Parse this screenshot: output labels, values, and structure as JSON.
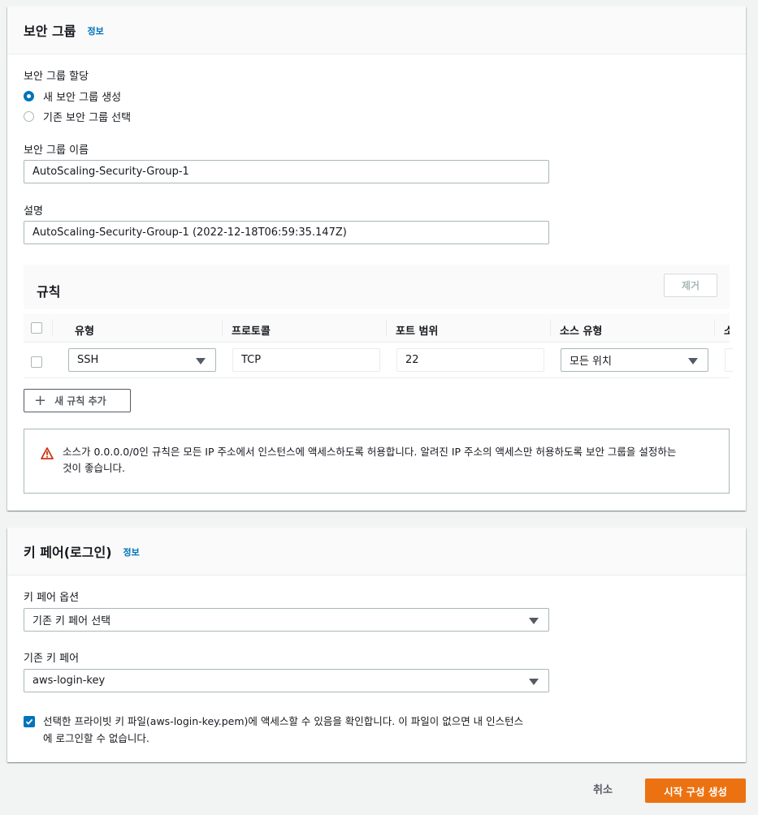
{
  "security_group": {
    "title": "보안 그룹",
    "info": "정보",
    "assign_label": "보안 그룹 할당",
    "radio_new": "새 보안 그룹 생성",
    "radio_existing": "기존 보안 그룹 선택",
    "name_label": "보안 그룹 이름",
    "name_value": "AutoScaling-Security-Group-1",
    "desc_label": "설명",
    "desc_value": "AutoScaling-Security-Group-1 (2022-12-18T06:59:35.147Z)",
    "rules": {
      "title": "규칙",
      "remove_label": "제거",
      "columns": [
        "유형",
        "프로토콜",
        "포트 범위",
        "소스 유형",
        "소"
      ],
      "rows": [
        {
          "type": "SSH",
          "protocol": "TCP",
          "port": "22",
          "source_type": "모든 위치"
        }
      ],
      "add_rule_label": "새 규칙 추가"
    },
    "warning_line1": "소스가 0.0.0.0/0인 규칙은 모든 IP 주소에서 인스턴스에 액세스하도록 허용합니다. 알려진 IP 주소의 액세스만 허용하도록 보안 그룹을 설정하는",
    "warning_line2": "것이 좋습니다."
  },
  "key_pair": {
    "title": "키 페어(로그인)",
    "info": "정보",
    "option_label": "키 페어 옵션",
    "option_value": "기존 키 페어 선택",
    "existing_label": "기존 키 페어",
    "existing_value": "aws-login-key",
    "ack_line1": "선택한 프라이빗 키 파일(aws-login-key.pem)에 액세스할 수 있음을 확인합니다. 이 파일이 없으면 내 인스턴스",
    "ack_line2": "에 로그인할 수 없습니다."
  },
  "footer": {
    "cancel_label": "취소",
    "create_label": "시작 구성 생성"
  },
  "colors": {
    "accent": "#0073bb",
    "primary_button": "#ec7211",
    "warning": "#d13212"
  }
}
